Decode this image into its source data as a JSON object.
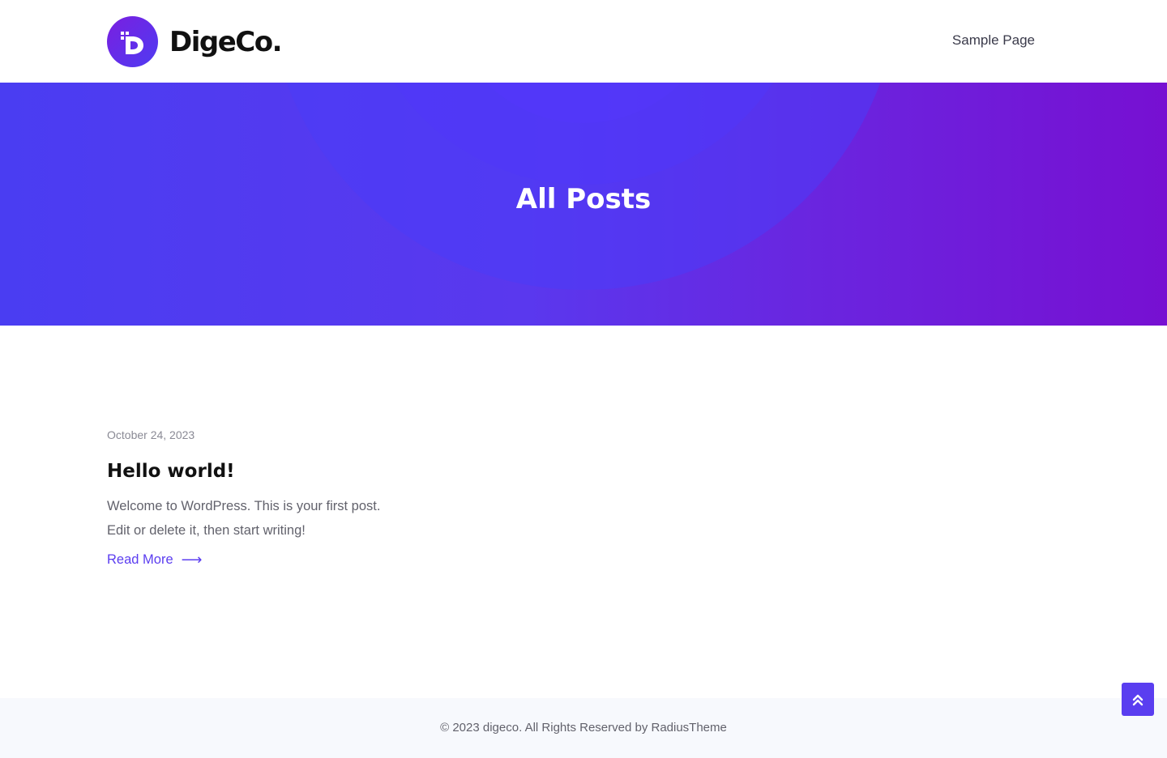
{
  "header": {
    "logo_text": "DigeCo.",
    "nav": [
      {
        "label": "Sample Page"
      }
    ]
  },
  "hero": {
    "title": "All Posts"
  },
  "posts": [
    {
      "date": "October 24, 2023",
      "title": "Hello world!",
      "excerpt": "Welcome to WordPress. This is your first post. Edit or delete it, then start writing!",
      "read_more": "Read More",
      "arrow": "⟶"
    }
  ],
  "footer": {
    "copyright": "© 2023 digeco. All Rights Reserved by RadiusTheme"
  },
  "colors": {
    "accent": "#5b3df0",
    "hero_gradient_start": "#4a3df2",
    "hero_gradient_end": "#7710d2",
    "footer_bg": "#f7f9fd"
  },
  "icons": {
    "logo_mark": "digeco-d-logo-icon",
    "back_to_top": "double-chevron-up-icon"
  }
}
